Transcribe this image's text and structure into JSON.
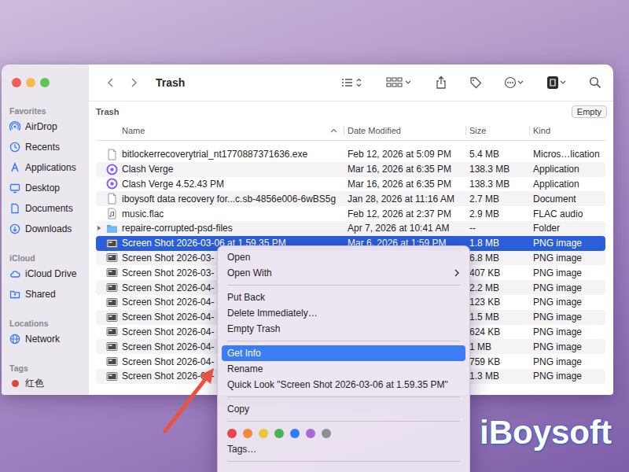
{
  "window": {
    "title": "Trash"
  },
  "sidebar": {
    "sections": [
      {
        "title": "Favorites",
        "items": [
          {
            "label": "AirDrop",
            "kind": "airdrop"
          },
          {
            "label": "Recents",
            "kind": "recents"
          },
          {
            "label": "Applications",
            "kind": "applications"
          },
          {
            "label": "Desktop",
            "kind": "desktop"
          },
          {
            "label": "Documents",
            "kind": "documents"
          },
          {
            "label": "Downloads",
            "kind": "downloads"
          }
        ]
      },
      {
        "title": "iCloud",
        "items": [
          {
            "label": "iCloud Drive",
            "kind": "cloud"
          },
          {
            "label": "Shared",
            "kind": "shared"
          }
        ]
      },
      {
        "title": "Locations",
        "items": [
          {
            "label": "Network",
            "kind": "network"
          }
        ]
      },
      {
        "title": "Tags",
        "items": [
          {
            "label": "红色",
            "kind": "tag",
            "color": "#e0443e"
          }
        ]
      }
    ]
  },
  "path_bar": {
    "location": "Trash",
    "button": "Empty"
  },
  "table": {
    "columns": [
      {
        "label": "Name",
        "sorted": true
      },
      {
        "label": "Date Modified",
        "sorted": false
      },
      {
        "label": "Size",
        "sorted": false
      },
      {
        "label": "Kind",
        "sorted": false
      }
    ],
    "rows": [
      {
        "name": "bitlockerrecoverytrial_nt1770887371636.exe",
        "date": "Feb 12, 2026 at 5:09 PM",
        "size": "5.4 MB",
        "type": "Micros…lication",
        "kind": "document",
        "selected": false
      },
      {
        "name": "Clash Verge",
        "date": "Mar 16, 2026 at 6:35 PM",
        "size": "138.3 MB",
        "type": "Application",
        "kind": "app",
        "selected": false
      },
      {
        "name": "Clash Verge 4.52.43 PM",
        "date": "Mar 16, 2026 at 6:35 PM",
        "size": "138.3 MB",
        "type": "Application",
        "kind": "app",
        "selected": false
      },
      {
        "name": "iboysoft data recovery for...c.sb-4856e006-6wBS5g",
        "date": "Jan 28, 2026 at 11:16 AM",
        "size": "2.7 MB",
        "type": "Document",
        "kind": "document",
        "selected": false
      },
      {
        "name": "music.flac",
        "date": "Feb 12, 2026 at 2:37 PM",
        "size": "2.9 MB",
        "type": "FLAC audio",
        "kind": "audio",
        "selected": false
      },
      {
        "name": "repaire-corrupted-psd-files",
        "date": "Apr 7, 2026 at 10:41 AM",
        "size": "--",
        "type": "Folder",
        "kind": "folder",
        "selected": false
      },
      {
        "name": "Screen Shot 2026-03-06 at 1.59.35 PM",
        "date": "Mar 6, 2026 at 1:59 PM",
        "size": "1.8 MB",
        "type": "PNG image",
        "kind": "image",
        "selected": true
      },
      {
        "name": "Screen Shot 2026-03-",
        "date": "",
        "size": "6.8 MB",
        "type": "PNG image",
        "kind": "image",
        "selected": false
      },
      {
        "name": "Screen Shot 2026-03-",
        "date": "",
        "size": "407 KB",
        "type": "PNG image",
        "kind": "image",
        "selected": false
      },
      {
        "name": "Screen Shot 2026-04-",
        "date": "",
        "size": "2.2 MB",
        "type": "PNG image",
        "kind": "image",
        "selected": false
      },
      {
        "name": "Screen Shot 2026-04-",
        "date": "",
        "size": "123 KB",
        "type": "PNG image",
        "kind": "image",
        "selected": false
      },
      {
        "name": "Screen Shot 2026-04-",
        "date": "",
        "size": "1.5 MB",
        "type": "PNG image",
        "kind": "image",
        "selected": false
      },
      {
        "name": "Screen Shot 2026-04-",
        "date": "",
        "size": "624 KB",
        "type": "PNG image",
        "kind": "image",
        "selected": false
      },
      {
        "name": "Screen Shot 2026-04-",
        "date": "",
        "size": "1 MB",
        "type": "PNG image",
        "kind": "image",
        "selected": false
      },
      {
        "name": "Screen Shot 2026-04-",
        "date": "",
        "size": "759 KB",
        "type": "PNG image",
        "kind": "image",
        "selected": false
      },
      {
        "name": "Screen Shot 2026-04-",
        "date": "",
        "size": "1.3 MB",
        "type": "PNG image",
        "kind": "image",
        "selected": false
      }
    ]
  },
  "context_menu": {
    "items": [
      {
        "kind": "item",
        "label": "Open",
        "submenu": false,
        "selected": false
      },
      {
        "kind": "item",
        "label": "Open With",
        "submenu": true,
        "selected": false
      },
      {
        "kind": "separator"
      },
      {
        "kind": "item",
        "label": "Put Back",
        "submenu": false,
        "selected": false
      },
      {
        "kind": "item",
        "label": "Delete Immediately…",
        "submenu": false,
        "selected": false
      },
      {
        "kind": "item",
        "label": "Empty Trash",
        "submenu": false,
        "selected": false
      },
      {
        "kind": "separator"
      },
      {
        "kind": "item",
        "label": "Get Info",
        "submenu": false,
        "selected": true
      },
      {
        "kind": "item",
        "label": "Rename",
        "submenu": false,
        "selected": false
      },
      {
        "kind": "item",
        "label": "Quick Look \"Screen Shot 2026-03-06 at 1.59.35 PM\"",
        "submenu": false,
        "selected": false
      },
      {
        "kind": "separator"
      },
      {
        "kind": "item",
        "label": "Copy",
        "submenu": false,
        "selected": false
      },
      {
        "kind": "separator"
      },
      {
        "kind": "colors",
        "colors": [
          {
            "color": "#e5484d"
          },
          {
            "color": "#f0883e"
          },
          {
            "color": "#e8c83a"
          },
          {
            "color": "#46b450"
          },
          {
            "color": "#2d7ff9"
          },
          {
            "color": "#a56ad6"
          },
          {
            "color": "#8e8e93"
          }
        ]
      },
      {
        "kind": "item",
        "label": "Tags…",
        "submenu": false,
        "selected": false
      },
      {
        "kind": "separator"
      }
    ]
  },
  "watermark": {
    "text": "iBoysoft"
  }
}
